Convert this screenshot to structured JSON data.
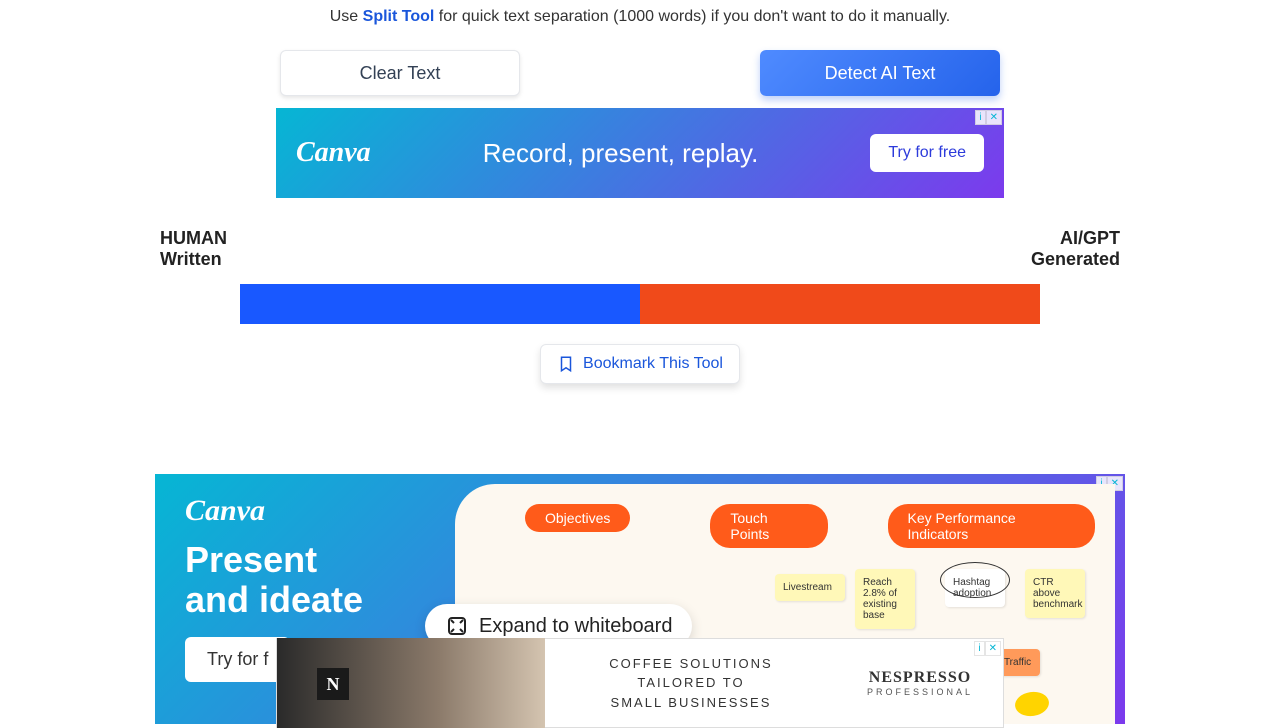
{
  "tip": {
    "prefix": "Use ",
    "link": "Split Tool",
    "suffix": " for quick text separation (1000 words) if you don't want to do it manually."
  },
  "buttons": {
    "clear": "Clear Text",
    "detect": "Detect AI Text"
  },
  "ad1": {
    "brand": "Canva",
    "text": "Record, present, replay.",
    "cta": "Try for free",
    "badge_i": "i",
    "badge_x": "✕"
  },
  "result": {
    "left_line1": "HUMAN",
    "left_line2": "Written",
    "right_line1": "AI/GPT",
    "right_line2": "Generated",
    "human_pct": 50,
    "ai_pct": 50
  },
  "bookmark": "Bookmark This Tool",
  "ad2": {
    "brand": "Canva",
    "headline1": "Present",
    "headline2": "and ideate",
    "cta": "Try for f",
    "cols": [
      "Objectives",
      "Touch Points",
      "Key Performance Indicators"
    ],
    "expand": "Expand to whiteboard",
    "stickies": {
      "livestream": "Livestream",
      "reach": "Reach 2.8% of existing base",
      "hashtag": "Hashtag adoption",
      "ctr": "CTR above benchmark",
      "traffic": "ot Traffic"
    },
    "badge_i": "i",
    "badge_x": "✕"
  },
  "ad3": {
    "text1": "COFFEE SOLUTIONS",
    "text2": "TAILORED TO",
    "text3": "SMALL BUSINESSES",
    "brand": "NESPRESSO",
    "sub": "PROFESSIONAL",
    "n": "N",
    "badge_i": "i",
    "badge_x": "✕"
  }
}
